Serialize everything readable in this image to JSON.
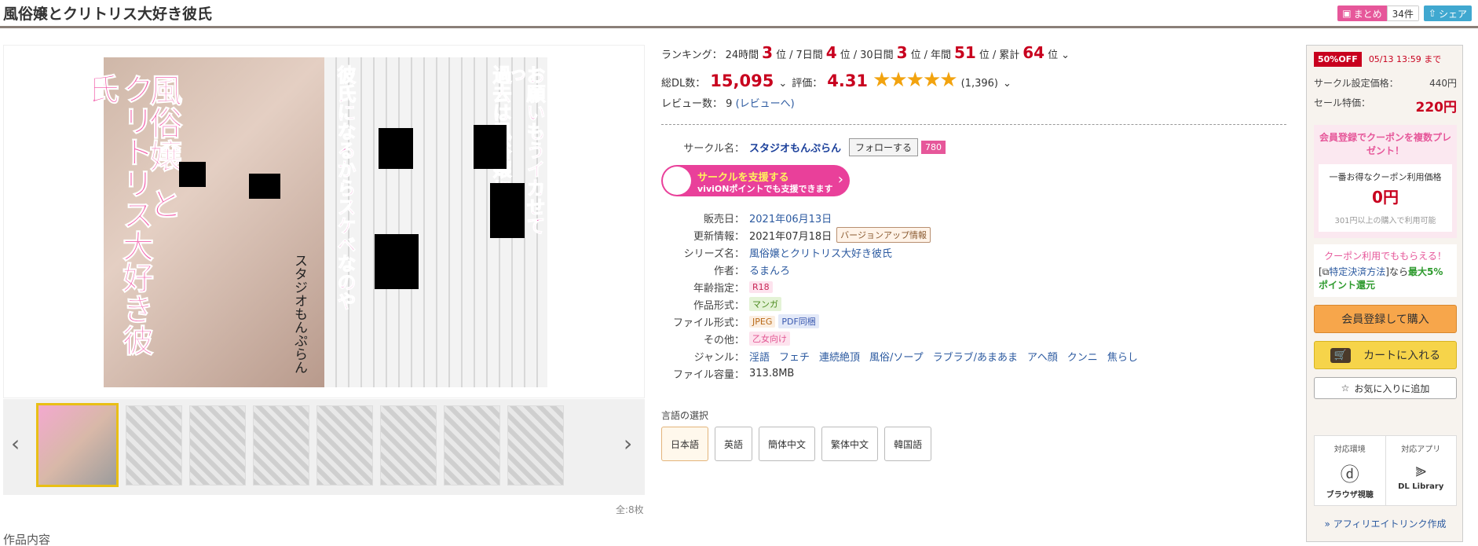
{
  "title": "風俗嬢とクリトリス大好き彼氏",
  "top_buttons": {
    "matome_label": "まとめ",
    "matome_count": "34件",
    "share_label": "シェア"
  },
  "cover": {
    "title_vertical_1": "風俗嬢",
    "title_vertical_2": "と",
    "title_vertical_3": "クリトリス大好き彼氏",
    "author_vertical": "スタジオもんぷらん",
    "side_text_1": "お願いもうイカせてっ",
    "side_text_2": "過去は風俗嬢に",
    "side_text_3": "彼氏になるからスケベなのや"
  },
  "gallery": {
    "count": "全:8枚",
    "prev_arrow": "‹",
    "next_arrow": "›"
  },
  "description_heading": "作品内容",
  "ranking": {
    "label": "ランキング：",
    "h24_label": "24時間",
    "h24_value": "3",
    "d7_label": "7日間",
    "d7_value": "4",
    "d30_label": "30日間",
    "d30_value": "3",
    "year_label": "年間",
    "year_value": "51",
    "total_label": "累計",
    "total_value": "64",
    "unit": "位",
    "sep": "/"
  },
  "downloads": {
    "label": "総DL数：",
    "value": "15,095",
    "rating_label": "評価：",
    "rating_value": "4.31",
    "rating_count": "(1,396)"
  },
  "reviews": {
    "label": "レビュー数：",
    "value": "9",
    "link": "(レビューへ)"
  },
  "circle": {
    "label": "サークル名：",
    "name": "スタジオもんぷらん",
    "follow": "フォローする",
    "follow_count": "780"
  },
  "support_banner": {
    "line1": "サークルを支援する",
    "line2": "viviONポイントでも支援できます"
  },
  "meta": [
    {
      "label": "販売日：",
      "value": "2021年06月13日"
    },
    {
      "label": "更新情報：",
      "value": "2021年07月18日",
      "tag": "バージョンアップ情報"
    },
    {
      "label": "シリーズ名：",
      "value": "風俗嬢とクリトリス大好き彼氏"
    },
    {
      "label": "作者：",
      "value": "るまんろ"
    },
    {
      "label": "年齢指定：",
      "tag": "R18"
    },
    {
      "label": "作品形式：",
      "tag": "マンガ"
    },
    {
      "label": "ファイル形式：",
      "tag": "JPEG",
      "tag2": "PDF同梱"
    },
    {
      "label": "その他：",
      "tag": "乙女向け"
    },
    {
      "label": "ジャンル：",
      "genres": [
        "淫語",
        "フェチ",
        "連続絶頂",
        "風俗/ソープ",
        "ラブラブ/あまあま",
        "アヘ顔",
        "クンニ",
        "焦らし"
      ]
    },
    {
      "label": "ファイル容量：",
      "value": "313.8MB"
    }
  ],
  "language": {
    "label": "言語の選択",
    "options": [
      "日本語",
      "英語",
      "簡体中文",
      "繁体中文",
      "韓国語"
    ],
    "selected": "日本語"
  },
  "sidebar": {
    "sale_badge": "50%OFF",
    "sale_deadline": "05/13 13:59 まで",
    "list_price_label": "サークル設定価格：",
    "list_price": "440円",
    "sale_price_label": "セール特価：",
    "sale_price": "220円",
    "coupon_heading": "会員登録でクーポンを複数プレゼント！",
    "coupon_best_label": "一番お得なクーポン利用価格",
    "coupon_best_price": "0円",
    "coupon_note": "301円以上の購入で利用可能",
    "coupon2_title": "クーポン利用でももらえる！",
    "coupon2_text_a": "[",
    "coupon2_link": "特定決済方法",
    "coupon2_text_b": "]なら",
    "coupon2_bonus": "最大5%ポイント還元",
    "buy_button": "会員登録して購入",
    "cart_button": "カートに入れる",
    "fav_button": "お気に入りに追加",
    "env_label": "対応環境",
    "env_name": "ブラウザ視聴",
    "app_label": "対応アプリ",
    "app_name": "DL Library",
    "affiliate": "» アフィリエイトリンク作成"
  },
  "colors": {
    "accent_red": "#c8001e",
    "pink": "#e6579a",
    "link_blue": "#2c5aa0"
  }
}
